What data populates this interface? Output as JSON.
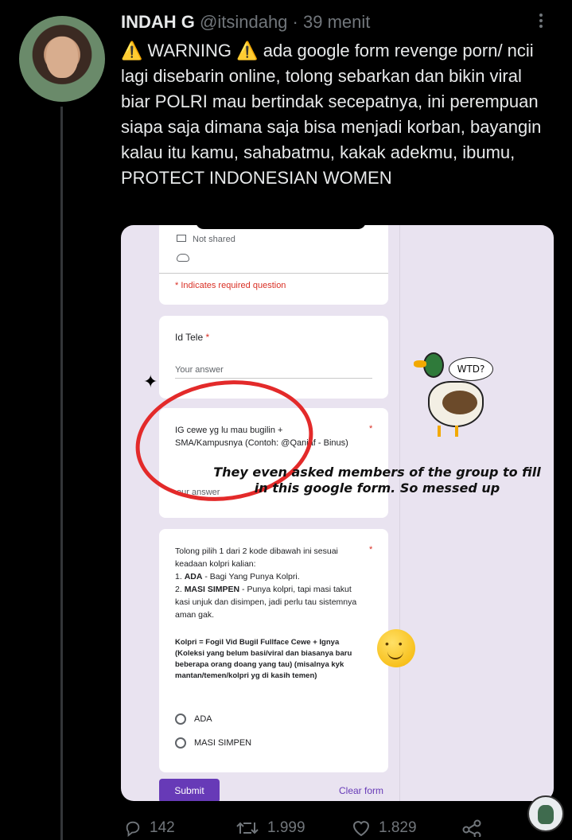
{
  "tweet": {
    "name": "INDAH G",
    "handle": "@itsindahg",
    "separator": "·",
    "time": "39 menit",
    "warning_icon": "⚠️",
    "text_warning_word": "WARNING",
    "text_body": "ada google form revenge porn/ ncii lagi disebarin online, tolong sebarkan dan bikin viral biar POLRI mau bertindak secepatnya, ini perempuan siapa saja dimana saja bisa menjadi korban, bayangin kalau itu kamu, sahabatmu, kakak adekmu, ibumu, PROTECT INDONESIAN WOMEN"
  },
  "form": {
    "not_shared": "Not shared",
    "required_note": "* Indicates required question",
    "q1_label": "Id Tele",
    "req_star": "*",
    "answer_placeholder": "Your answer",
    "q2_label": "IG cewe yg lu mau bugilin + SMA/Kampusnya (Contoh: @Qaniaf - Binus)",
    "q2_answer_fragment": "our answer",
    "q3_intro": "Tolong pilih 1 dari 2 kode dibawah ini sesuai keadaan kolpri kalian:",
    "q3_opt1_bold": "ADA",
    "q3_opt1_rest": " - Bagi Yang Punya Kolpri.",
    "q3_opt2_bold": "MASI SIMPEN",
    "q3_opt2_rest": " - Punya kolpri, tapi masi takut kasi unjuk dan disimpen, jadi perlu tau sistemnya aman gak.",
    "q3_note": "Kolpri = Fogil Vid Bugil Fullface Cewe + Ignya (Koleksi yang belum basi/viral dan biasanya baru beberapa orang doang yang tau) (misalnya kyk mantan/temen/kolpri yg di kasih temen)",
    "radio1": "ADA",
    "radio2": "MASI SIMPEN",
    "submit": "Submit",
    "clear": "Clear form"
  },
  "overlay": {
    "caption": "They even asked members of the group to fill in this google form. So messed up",
    "bubble": "WTD?"
  },
  "actions": {
    "replies": "142",
    "retweets": "1.999",
    "likes": "1.829"
  },
  "icons": {
    "reply": "reply-icon",
    "retweet": "retweet-icon",
    "like": "heart-icon",
    "share": "share-icon",
    "more": "more-icon"
  },
  "colors": {
    "background": "#000000",
    "text": "#e7e9ea",
    "muted": "#71767b",
    "form_accent": "#673ab7",
    "marker_red": "#e32a2a"
  }
}
